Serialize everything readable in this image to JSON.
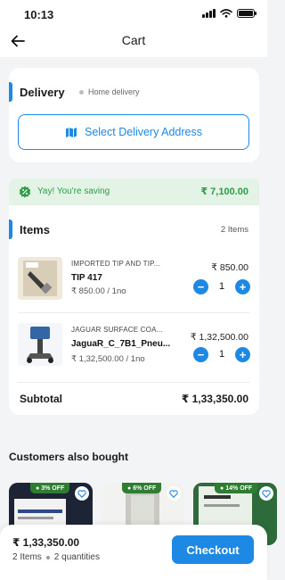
{
  "status_bar": {
    "time": "10:13"
  },
  "header": {
    "title": "Cart"
  },
  "delivery": {
    "title": "Delivery",
    "mode": "Home delivery",
    "select_address_label": "Select Delivery Address"
  },
  "savings": {
    "text": "Yay! You're saving",
    "amount": "₹ 7,100.00"
  },
  "items_section": {
    "title": "Items",
    "count": "2 Items",
    "items": [
      {
        "name": "IMPORTED TIP AND TIP...",
        "code": "TIP 417",
        "unit_price": "₹ 850.00 / 1no",
        "total": "₹ 850.00",
        "qty": "1",
        "minus": "−",
        "plus": "+"
      },
      {
        "name": "JAGUAR SURFACE COA...",
        "code": "JaguaR_C_7B1_Pneu...",
        "unit_price": "₹ 1,32,500.00 / 1no",
        "total": "₹ 1,32,500.00",
        "qty": "1",
        "minus": "−",
        "plus": "+"
      }
    ],
    "subtotal_label": "Subtotal",
    "subtotal_value": "₹ 1,33,350.00"
  },
  "also_bought": {
    "title": "Customers also bought",
    "products": [
      {
        "discount": "3% OFF"
      },
      {
        "discount": "6% OFF"
      },
      {
        "discount": "14% OFF"
      }
    ]
  },
  "bottom_bar": {
    "total": "₹ 1,33,350.00",
    "items_count": "2 Items",
    "quantities": "2 quantities",
    "checkout_label": "Checkout"
  },
  "colors": {
    "accent": "#1e88e5",
    "saving_green": "#2e9b47",
    "badge_green": "#2e7d32"
  }
}
